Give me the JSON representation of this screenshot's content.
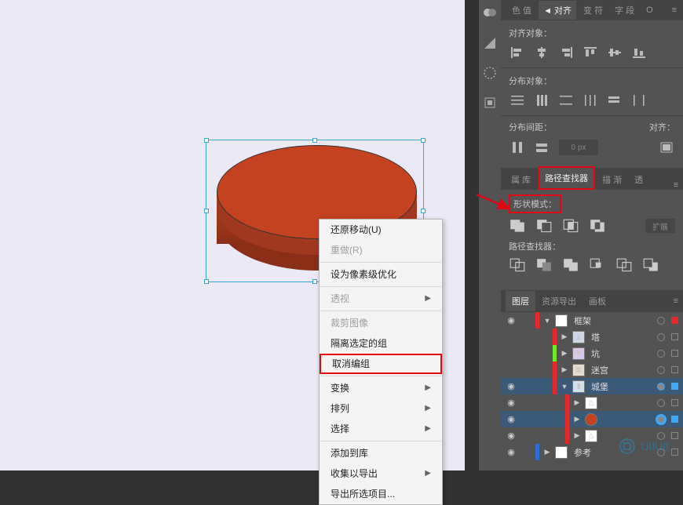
{
  "tabs1": {
    "color": "色 值",
    "align": "◄ 对齐",
    "char": "变 符",
    "para": "字 段",
    "op": "O"
  },
  "align": {
    "alignObjects": "对齐对象：",
    "distributeObjects": "分布对象：",
    "distributeSpacing": "分布间距：",
    "alignTo": "对齐：",
    "px": "0  px"
  },
  "tabs2": {
    "props": "属 库",
    "pathfinder": "路径查找器",
    "stroke": "描 渐",
    "trans": "透"
  },
  "pathfinder": {
    "shapeMode": "形状模式：",
    "expand": "扩展",
    "pathfinders": "路径查找器："
  },
  "layers": {
    "tabLayers": "图层",
    "tabAssets": "资源导出",
    "tabArtboards": "画板",
    "rows": [
      {
        "name": "框架"
      },
      {
        "name": "塔"
      },
      {
        "name": "坑"
      },
      {
        "name": "迷宫"
      },
      {
        "name": "城堡"
      },
      {
        "name": ""
      },
      {
        "name": ""
      },
      {
        "name": ""
      },
      {
        "name": "参考"
      }
    ]
  },
  "contextMenu": {
    "undo": "还原移动(U)",
    "redo": "重做(R)",
    "pixelPerfect": "设为像素级优化",
    "perspective": "透视",
    "crop": "裁剪图像",
    "isolate": "隔离选定的组",
    "ungroup": "取消编组",
    "transform": "变换",
    "arrange": "排列",
    "select": "选择",
    "addToLib": "添加到库",
    "collectExport": "收集以导出",
    "exportSelection": "导出所选项目..."
  },
  "watermark": "UIIUII"
}
